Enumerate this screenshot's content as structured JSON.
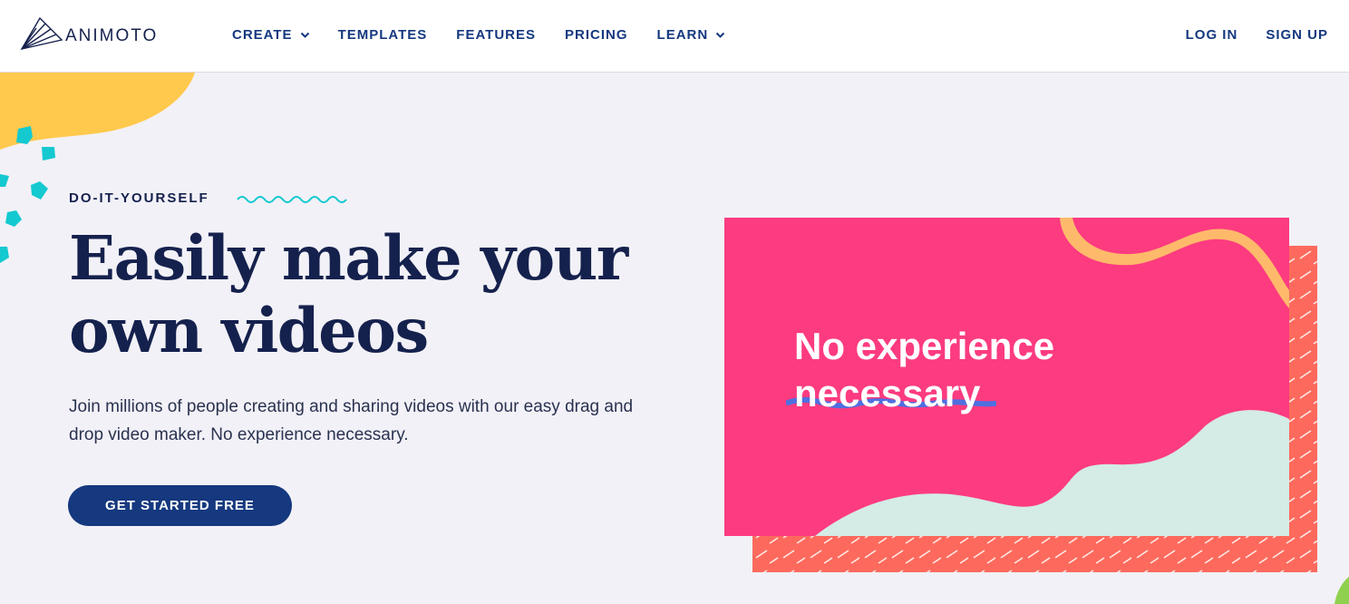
{
  "brand": {
    "name": "ANIMOTO",
    "colors": {
      "navy": "#15214d",
      "blue": "#15387f",
      "pink": "#fd3b80",
      "coral": "#fd6a5d",
      "mint": "#d4ebe6",
      "yellow": "#ffc94d",
      "teal": "#14c9d0"
    }
  },
  "nav": {
    "items": [
      {
        "label": "CREATE",
        "has_dropdown": true
      },
      {
        "label": "TEMPLATES",
        "has_dropdown": false
      },
      {
        "label": "FEATURES",
        "has_dropdown": false
      },
      {
        "label": "PRICING",
        "has_dropdown": false
      },
      {
        "label": "LEARN",
        "has_dropdown": true
      }
    ],
    "login_label": "LOG IN",
    "signup_label": "SIGN UP"
  },
  "hero": {
    "eyebrow": "DO-IT-YOURSELF",
    "headline_line1": "Easily make your",
    "headline_line2": "own videos",
    "subtext": "Join millions of people creating and sharing videos with our easy drag and drop video maker. No experience necessary.",
    "cta_label": "GET STARTED FREE"
  },
  "card": {
    "title_line1": "No experience",
    "title_line2": "necessary"
  }
}
